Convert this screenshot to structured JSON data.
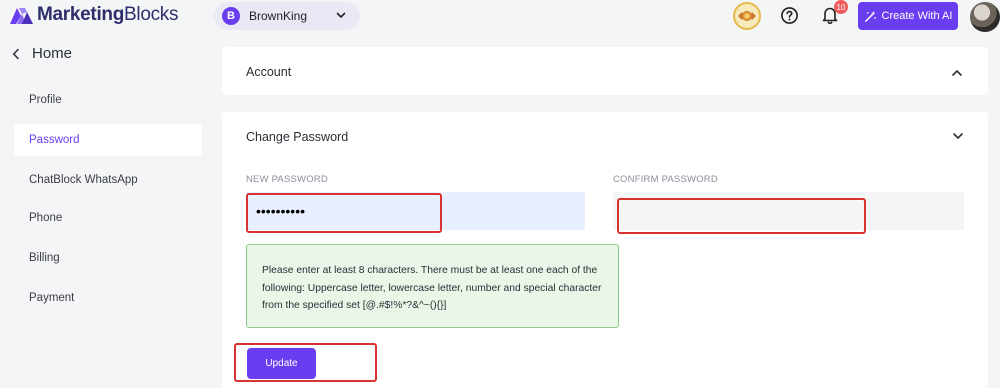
{
  "brand": {
    "name_bold": "Marketing",
    "name_rest": "Blocks",
    "logo_colors": [
      "#6a3df0",
      "#8b6cf5",
      "#4a2db8"
    ]
  },
  "workspace": {
    "initial": "B",
    "name": "BrownKing"
  },
  "topbar": {
    "notification_count": "10",
    "create_ai_label": "Create With AI",
    "accent_color": "#6a3df0"
  },
  "sidebar": {
    "back_label": "Home",
    "items": [
      {
        "label": "Profile",
        "active": false
      },
      {
        "label": "Password",
        "active": true
      },
      {
        "label": "ChatBlock WhatsApp",
        "active": false
      },
      {
        "label": "Phone",
        "active": false
      },
      {
        "label": "Billing",
        "active": false
      },
      {
        "label": "Payment",
        "active": false
      }
    ]
  },
  "account_card": {
    "title": "Account",
    "expanded": true
  },
  "password_card": {
    "title": "Change Password",
    "new_password_label": "NEW PASSWORD",
    "new_password_value": "••••••••••",
    "confirm_password_label": "CONFIRM PASSWORD",
    "confirm_password_value": "",
    "hint": "Please enter at least 8 characters. There must be at least one each of the following: Uppercase letter, lowercase letter, number and special character from the specified set [@.#$!%*?&^~(){}]",
    "update_label": "Update"
  }
}
